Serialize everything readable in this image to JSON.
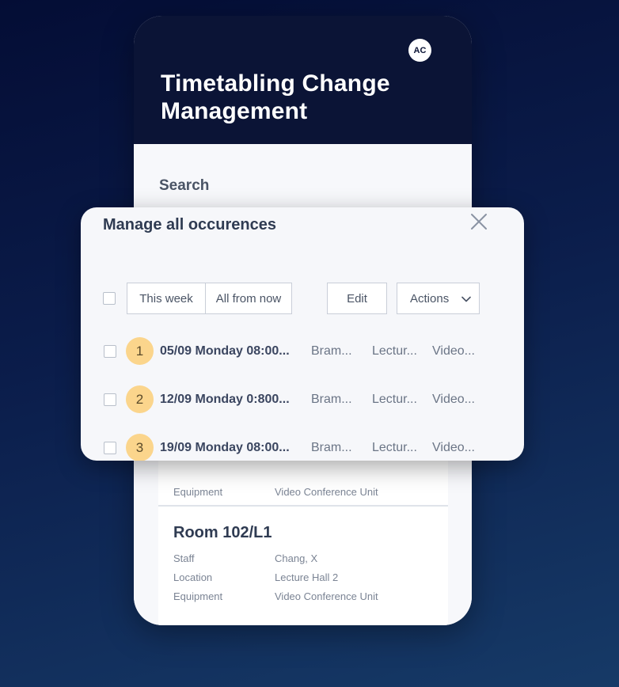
{
  "app": {
    "avatar_initials": "AC",
    "title": "Timetabling Change Management"
  },
  "search": {
    "label": "Search"
  },
  "background_cards": [
    {
      "equipment_label": "Equipment",
      "equipment_value": "Video Conference Unit"
    },
    {
      "room": "Room 102/L1",
      "staff_label": "Staff",
      "staff_value": "Chang, X",
      "location_label": "Location",
      "location_value": "Lecture Hall 2",
      "equipment_label": "Equipment",
      "equipment_value": "Video Conference Unit"
    }
  ],
  "modal": {
    "title": "Manage all occurences",
    "toolbar": {
      "this_week": "This week",
      "all_from_now": "All from now",
      "edit": "Edit",
      "actions": "Actions"
    },
    "occurrences": [
      {
        "number": "1",
        "date": "05/09 Monday 08:00...",
        "location": "Bram...",
        "type": "Lectur...",
        "equipment": "Video..."
      },
      {
        "number": "2",
        "date": "12/09 Monday 0:800...",
        "location": "Bram...",
        "type": "Lectur...",
        "equipment": "Video..."
      },
      {
        "number": "3",
        "date": "19/09 Monday 08:00...",
        "location": "Bram...",
        "type": "Lectur...",
        "equipment": "Video..."
      }
    ]
  },
  "colors": {
    "header_bg": "#0b1436",
    "badge_bg": "#fbd58c",
    "modal_bg": "#f6f7fa"
  },
  "icons": {
    "close": "close-icon",
    "dropdown": "chevron-down-icon"
  }
}
